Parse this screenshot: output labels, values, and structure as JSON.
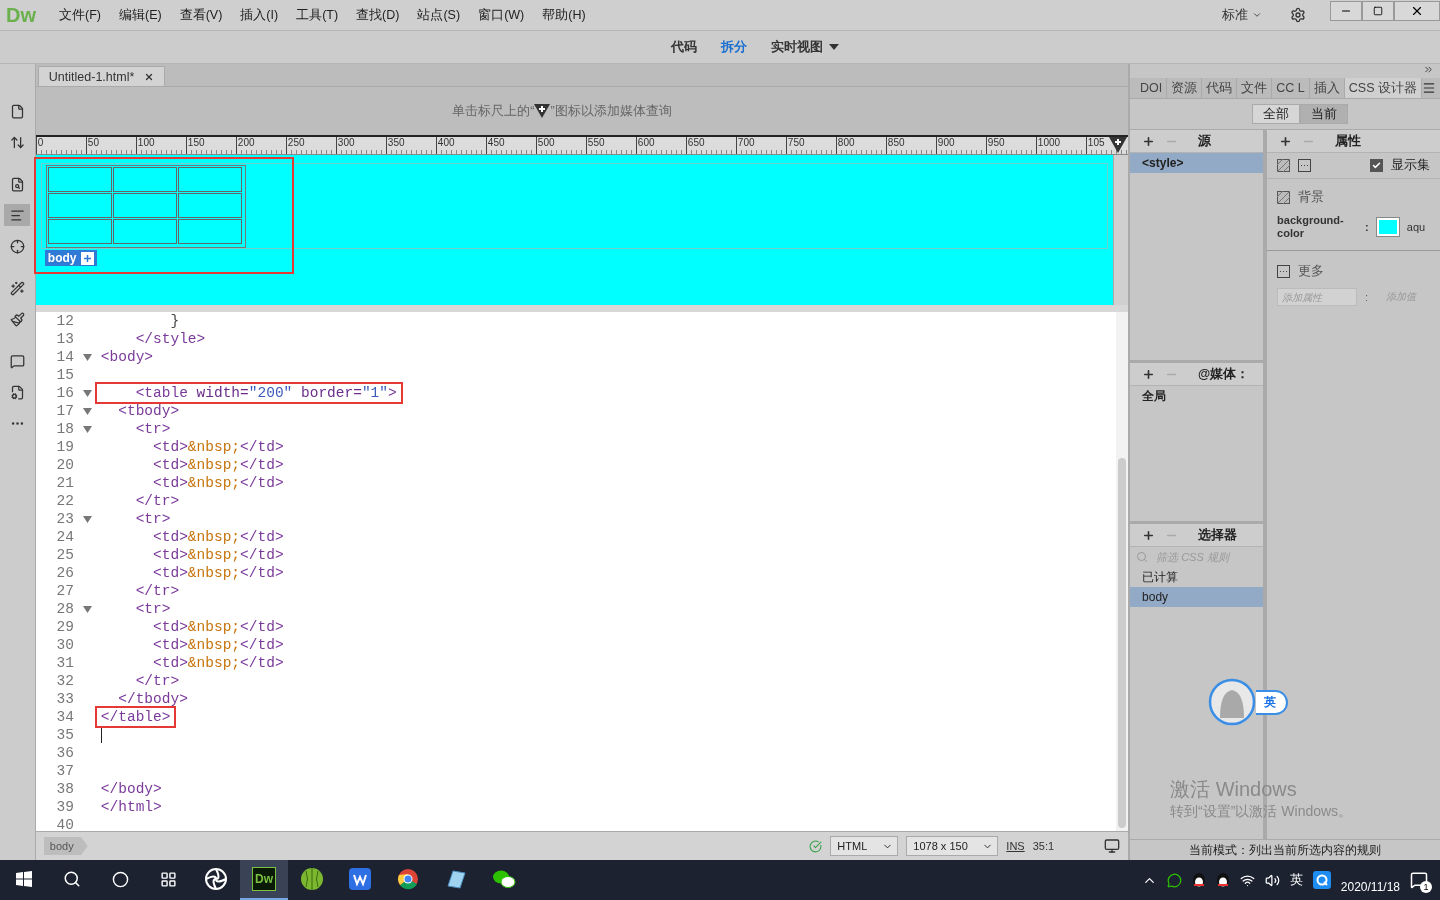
{
  "app": {
    "logo": "Dw",
    "menu": [
      "文件(F)",
      "编辑(E)",
      "查看(V)",
      "插入(I)",
      "工具(T)",
      "查找(D)",
      "站点(S)",
      "窗口(W)",
      "帮助(H)"
    ],
    "workspace": "标准"
  },
  "view_switcher": [
    {
      "label": "代码",
      "selected": false
    },
    {
      "label": "拆分",
      "selected": true
    },
    {
      "label": "实时视图",
      "selected": false
    }
  ],
  "document_tab": {
    "title": "Untitled-1.html*"
  },
  "media_hint": {
    "before": "单击标尺上的“",
    "after": "”图标以添加媒体查询"
  },
  "ruler": {
    "labels": [
      "0",
      "50",
      "100",
      "150",
      "200",
      "250",
      "300",
      "350",
      "400",
      "450",
      "500",
      "550",
      "600",
      "650",
      "700",
      "750",
      "800",
      "850",
      "900",
      "950",
      "1000",
      "105"
    ]
  },
  "design": {
    "annotated": true,
    "table": [
      {
        "cells": [
          {
            "kind": "empty"
          },
          {
            "kind": "empty"
          },
          {
            "kind": "empty"
          }
        ]
      },
      {
        "cells": [
          {
            "kind": "empty"
          },
          {
            "kind": "empty"
          },
          {
            "kind": "empty"
          }
        ]
      },
      {
        "cells": [
          {
            "kind": "empty"
          },
          {
            "kind": "empty"
          },
          {
            "kind": "empty"
          }
        ]
      }
    ],
    "tag": "body"
  },
  "code_lines": [
    {
      "number": "12",
      "fold": false,
      "boxed": false,
      "segments": [
        {
          "kind": "plain",
          "text": "        }"
        }
      ]
    },
    {
      "number": "13",
      "fold": false,
      "boxed": false,
      "segments": [
        {
          "kind": "tag",
          "text": "    </style>"
        }
      ]
    },
    {
      "number": "14",
      "fold": true,
      "boxed": false,
      "segments": [
        {
          "kind": "tag",
          "text": "<body>"
        }
      ]
    },
    {
      "number": "15",
      "fold": false
    },
    {
      "number": "16",
      "fold": true,
      "boxed": true,
      "segments": [
        {
          "kind": "tag",
          "text": "    <table"
        },
        {
          "kind": "attr",
          "text": " width="
        },
        {
          "kind": "value",
          "text": "\"200\""
        },
        {
          "kind": "attr",
          "text": " border="
        },
        {
          "kind": "value",
          "text": "\"1\""
        },
        {
          "kind": "tag",
          "text": ">"
        }
      ]
    },
    {
      "number": "17",
      "fold": true,
      "boxed": false,
      "segments": [
        {
          "kind": "tag",
          "text": "  <tbody>"
        }
      ]
    },
    {
      "number": "18",
      "fold": true,
      "boxed": false,
      "segments": [
        {
          "kind": "tag",
          "text": "    <tr>"
        }
      ]
    },
    {
      "number": "19",
      "fold": false,
      "boxed": false,
      "segments": [
        {
          "kind": "tag",
          "text": "      <td>"
        },
        {
          "kind": "entity",
          "text": "&nbsp;"
        },
        {
          "kind": "tag",
          "text": "</td>"
        }
      ]
    },
    {
      "number": "20",
      "fold": false,
      "boxed": false,
      "segments": [
        {
          "kind": "tag",
          "text": "      <td>"
        },
        {
          "kind": "entity",
          "text": "&nbsp;"
        },
        {
          "kind": "tag",
          "text": "</td>"
        }
      ]
    },
    {
      "number": "21",
      "fold": false,
      "boxed": false,
      "segments": [
        {
          "kind": "tag",
          "text": "      <td>"
        },
        {
          "kind": "entity",
          "text": "&nbsp;"
        },
        {
          "kind": "tag",
          "text": "</td>"
        }
      ]
    },
    {
      "number": "22",
      "fold": false,
      "boxed": false,
      "segments": [
        {
          "kind": "tag",
          "text": "    </tr>"
        }
      ]
    },
    {
      "number": "23",
      "fold": true,
      "boxed": false,
      "segments": [
        {
          "kind": "tag",
          "text": "    <tr>"
        }
      ]
    },
    {
      "number": "24",
      "fold": false,
      "boxed": false,
      "segments": [
        {
          "kind": "tag",
          "text": "      <td>"
        },
        {
          "kind": "entity",
          "text": "&nbsp;"
        },
        {
          "kind": "tag",
          "text": "</td>"
        }
      ]
    },
    {
      "number": "25",
      "fold": false,
      "boxed": false,
      "segments": [
        {
          "kind": "tag",
          "text": "      <td>"
        },
        {
          "kind": "entity",
          "text": "&nbsp;"
        },
        {
          "kind": "tag",
          "text": "</td>"
        }
      ]
    },
    {
      "number": "26",
      "fold": false,
      "boxed": false,
      "segments": [
        {
          "kind": "tag",
          "text": "      <td>"
        },
        {
          "kind": "entity",
          "text": "&nbsp;"
        },
        {
          "kind": "tag",
          "text": "</td>"
        }
      ]
    },
    {
      "number": "27",
      "fold": false,
      "boxed": false,
      "segments": [
        {
          "kind": "tag",
          "text": "    </tr>"
        }
      ]
    },
    {
      "number": "28",
      "fold": true,
      "boxed": false,
      "segments": [
        {
          "kind": "tag",
          "text": "    <tr>"
        }
      ]
    },
    {
      "number": "29",
      "fold": false,
      "boxed": false,
      "segments": [
        {
          "kind": "tag",
          "text": "      <td>"
        },
        {
          "kind": "entity",
          "text": "&nbsp;"
        },
        {
          "kind": "tag",
          "text": "</td>"
        }
      ]
    },
    {
      "number": "30",
      "fold": false,
      "boxed": false,
      "segments": [
        {
          "kind": "tag",
          "text": "      <td>"
        },
        {
          "kind": "entity",
          "text": "&nbsp;"
        },
        {
          "kind": "tag",
          "text": "</td>"
        }
      ]
    },
    {
      "number": "31",
      "fold": false,
      "boxed": false,
      "segments": [
        {
          "kind": "tag",
          "text": "      <td>"
        },
        {
          "kind": "entity",
          "text": "&nbsp;"
        },
        {
          "kind": "tag",
          "text": "</td>"
        }
      ]
    },
    {
      "number": "32",
      "fold": false,
      "boxed": false,
      "segments": [
        {
          "kind": "tag",
          "text": "    </tr>"
        }
      ]
    },
    {
      "number": "33",
      "fold": false,
      "boxed": false,
      "segments": [
        {
          "kind": "tag",
          "text": "  </tbody>"
        }
      ]
    },
    {
      "number": "34",
      "fold": false,
      "boxed": true,
      "segments": [
        {
          "kind": "tag",
          "text": "</table>"
        }
      ]
    },
    {
      "number": "35",
      "fold": false
    },
    {
      "number": "36",
      "fold": false
    },
    {
      "number": "37",
      "fold": false
    },
    {
      "number": "38",
      "fold": false,
      "boxed": false,
      "segments": [
        {
          "kind": "tag",
          "text": "</body>"
        }
      ]
    },
    {
      "number": "39",
      "fold": false,
      "boxed": false,
      "segments": [
        {
          "kind": "tag",
          "text": "</html>"
        }
      ]
    },
    {
      "number": "40",
      "fold": false
    }
  ],
  "status_bar": {
    "tag": "body",
    "language": "HTML",
    "size": "1078 x 150",
    "mode": "INS",
    "position": "35:1"
  },
  "panel": {
    "tabs": [
      {
        "label": "DOI",
        "selected": false
      },
      {
        "label": "资源",
        "selected": false
      },
      {
        "label": "代码",
        "selected": false
      },
      {
        "label": "文件",
        "selected": false
      },
      {
        "label": "CC L",
        "selected": false
      },
      {
        "label": "插入",
        "selected": false
      },
      {
        "label": "CSS 设计器",
        "selected": true
      }
    ],
    "scope": [
      {
        "label": "全部",
        "selected": false
      },
      {
        "label": "当前",
        "selected": true
      }
    ],
    "sources": {
      "title": "源",
      "items": [
        {
          "label": "<style>",
          "selected": true
        }
      ]
    },
    "media": {
      "title": "@媒体：",
      "items": [
        {
          "label": "全局",
          "selected": false
        }
      ]
    },
    "selectors": {
      "title": "选择器",
      "placeholder": "筛选 CSS 规则",
      "items": [
        {
          "label": "已计算",
          "selected": false
        },
        {
          "label": "body",
          "selected": true
        }
      ]
    },
    "properties": {
      "title": "属性",
      "show_set": {
        "label": "显示集",
        "checked": true
      },
      "section": "背景",
      "property": {
        "name": "background-color",
        "colon": ":",
        "color": "#00ffff",
        "value": "aqu"
      },
      "more": "更多",
      "add_property": {
        "placeholder": "添加属性"
      },
      "add_colon": ":",
      "add_value": "添加值"
    },
    "mode_text": "当前模式：列出当前所选内容的规则"
  },
  "ime": {
    "label": "英"
  },
  "activation": {
    "title": "激活 Windows",
    "subtitle": "转到“设置”以激活 Windows。"
  },
  "taskbar": {
    "apps": [
      {
        "kind": "dw",
        "label": "Dw",
        "selected": true
      },
      {
        "kind": "ball",
        "selected": false
      },
      {
        "kind": "wps",
        "selected": false
      },
      {
        "kind": "chrome",
        "selected": false
      },
      {
        "kind": "note",
        "selected": false
      },
      {
        "kind": "wechat",
        "selected": false
      }
    ],
    "tray_lang": "英",
    "date": "2020/11/18",
    "notifications": "1"
  }
}
